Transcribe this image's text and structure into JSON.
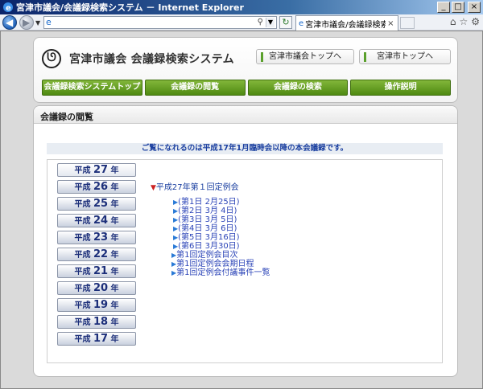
{
  "window": {
    "title": "宮津市議会/会議録検索システム － Internet Explorer",
    "minimize": "_",
    "maximize": "□",
    "close": "×"
  },
  "browser": {
    "address_value": "",
    "tab_label": "宮津市議会/会議録検索シ..."
  },
  "site": {
    "title": "宮津市議会 会議録検索システム",
    "top_links": [
      "宮津市議会トップへ",
      "宮津市トップへ"
    ],
    "menu": [
      "会議録検索システムトップ",
      "会議録の閲覧",
      "会議録の検索",
      "操作説明"
    ]
  },
  "content": {
    "section_title": "会議録の閲覧",
    "notice": "ご覧になれるのは平成17年1月臨時会以降の本会議録です。",
    "years": [
      {
        "prefix": "平成",
        "num": "27",
        "suffix": "年"
      },
      {
        "prefix": "平成",
        "num": "26",
        "suffix": "年"
      },
      {
        "prefix": "平成",
        "num": "25",
        "suffix": "年"
      },
      {
        "prefix": "平成",
        "num": "24",
        "suffix": "年"
      },
      {
        "prefix": "平成",
        "num": "23",
        "suffix": "年"
      },
      {
        "prefix": "平成",
        "num": "22",
        "suffix": "年"
      },
      {
        "prefix": "平成",
        "num": "21",
        "suffix": "年"
      },
      {
        "prefix": "平成",
        "num": "20",
        "suffix": "年"
      },
      {
        "prefix": "平成",
        "num": "19",
        "suffix": "年"
      },
      {
        "prefix": "平成",
        "num": "18",
        "suffix": "年"
      },
      {
        "prefix": "平成",
        "num": "17",
        "suffix": "年"
      }
    ],
    "session_title": "平成27年第１回定例会",
    "session_items": [
      "(第1日 2月25日)",
      "(第2日 3月 4日)",
      "(第3日 3月 5日)",
      "(第4日 3月 6日)",
      "(第5日 3月16日)",
      "(第6日 3月30日)"
    ],
    "session_docs": [
      "第1回定例会目次",
      "第1回定例会会期日程",
      "第1回定例会付議事件一覧"
    ]
  }
}
